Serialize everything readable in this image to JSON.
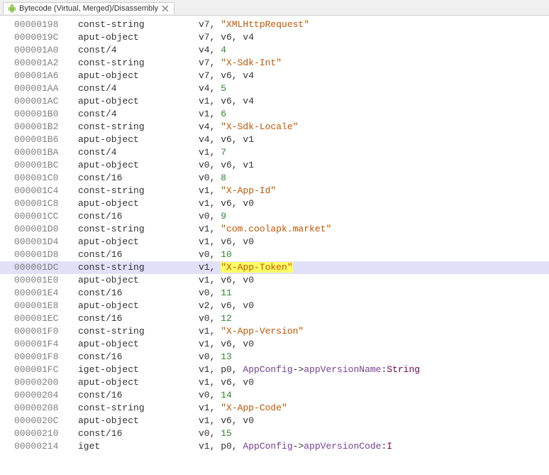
{
  "tab": {
    "title": "Bytecode (Virtual, Merged)/Disassembly",
    "icon_name": "android-icon"
  },
  "rows": [
    {
      "addr": "00000198",
      "op": "const-string",
      "args": [
        {
          "t": "plain",
          "v": "v7, "
        },
        {
          "t": "str",
          "v": "\"XMLHttpRequest\""
        }
      ]
    },
    {
      "addr": "0000019C",
      "op": "aput-object",
      "args": [
        {
          "t": "plain",
          "v": "v7, v6, v4"
        }
      ]
    },
    {
      "addr": "000001A0",
      "op": "const/4",
      "args": [
        {
          "t": "plain",
          "v": "v4, "
        },
        {
          "t": "num",
          "v": "4"
        }
      ]
    },
    {
      "addr": "000001A2",
      "op": "const-string",
      "args": [
        {
          "t": "plain",
          "v": "v7, "
        },
        {
          "t": "str",
          "v": "\"X-Sdk-Int\""
        }
      ]
    },
    {
      "addr": "000001A6",
      "op": "aput-object",
      "args": [
        {
          "t": "plain",
          "v": "v7, v6, v4"
        }
      ]
    },
    {
      "addr": "000001AA",
      "op": "const/4",
      "args": [
        {
          "t": "plain",
          "v": "v4, "
        },
        {
          "t": "num",
          "v": "5"
        }
      ]
    },
    {
      "addr": "000001AC",
      "op": "aput-object",
      "args": [
        {
          "t": "plain",
          "v": "v1, v6, v4"
        }
      ]
    },
    {
      "addr": "000001B0",
      "op": "const/4",
      "args": [
        {
          "t": "plain",
          "v": "v1, "
        },
        {
          "t": "num",
          "v": "6"
        }
      ]
    },
    {
      "addr": "000001B2",
      "op": "const-string",
      "args": [
        {
          "t": "plain",
          "v": "v4, "
        },
        {
          "t": "str",
          "v": "\"X-Sdk-Locale\""
        }
      ]
    },
    {
      "addr": "000001B6",
      "op": "aput-object",
      "args": [
        {
          "t": "plain",
          "v": "v4, v6, v1"
        }
      ]
    },
    {
      "addr": "000001BA",
      "op": "const/4",
      "args": [
        {
          "t": "plain",
          "v": "v1, "
        },
        {
          "t": "num",
          "v": "7"
        }
      ]
    },
    {
      "addr": "000001BC",
      "op": "aput-object",
      "args": [
        {
          "t": "plain",
          "v": "v0, v6, v1"
        }
      ]
    },
    {
      "addr": "000001C0",
      "op": "const/16",
      "args": [
        {
          "t": "plain",
          "v": "v0, "
        },
        {
          "t": "num",
          "v": "8"
        }
      ]
    },
    {
      "addr": "000001C4",
      "op": "const-string",
      "args": [
        {
          "t": "plain",
          "v": "v1, "
        },
        {
          "t": "str",
          "v": "\"X-App-Id\""
        }
      ]
    },
    {
      "addr": "000001C8",
      "op": "aput-object",
      "args": [
        {
          "t": "plain",
          "v": "v1, v6, v0"
        }
      ]
    },
    {
      "addr": "000001CC",
      "op": "const/16",
      "args": [
        {
          "t": "plain",
          "v": "v0, "
        },
        {
          "t": "num",
          "v": "9"
        }
      ]
    },
    {
      "addr": "000001D0",
      "op": "const-string",
      "args": [
        {
          "t": "plain",
          "v": "v1, "
        },
        {
          "t": "str",
          "v": "\"com.coolapk.market\""
        }
      ]
    },
    {
      "addr": "000001D4",
      "op": "aput-object",
      "args": [
        {
          "t": "plain",
          "v": "v1, v6, v0"
        }
      ]
    },
    {
      "addr": "000001D8",
      "op": "const/16",
      "args": [
        {
          "t": "plain",
          "v": "v0, "
        },
        {
          "t": "num",
          "v": "10"
        }
      ]
    },
    {
      "addr": "000001DC",
      "op": "const-string",
      "hl": true,
      "args": [
        {
          "t": "plain",
          "v": "v1, "
        },
        {
          "t": "strmark",
          "v": "\"X-App-Token\""
        }
      ]
    },
    {
      "addr": "000001E0",
      "op": "aput-object",
      "args": [
        {
          "t": "plain",
          "v": "v1, v6, v0"
        }
      ]
    },
    {
      "addr": "000001E4",
      "op": "const/16",
      "args": [
        {
          "t": "plain",
          "v": "v0, "
        },
        {
          "t": "num",
          "v": "11"
        }
      ]
    },
    {
      "addr": "000001E8",
      "op": "aput-object",
      "args": [
        {
          "t": "plain",
          "v": "v2, v6, v0"
        }
      ]
    },
    {
      "addr": "000001EC",
      "op": "const/16",
      "args": [
        {
          "t": "plain",
          "v": "v0, "
        },
        {
          "t": "num",
          "v": "12"
        }
      ]
    },
    {
      "addr": "000001F0",
      "op": "const-string",
      "args": [
        {
          "t": "plain",
          "v": "v1, "
        },
        {
          "t": "str",
          "v": "\"X-App-Version\""
        }
      ]
    },
    {
      "addr": "000001F4",
      "op": "aput-object",
      "args": [
        {
          "t": "plain",
          "v": "v1, v6, v0"
        }
      ]
    },
    {
      "addr": "000001F8",
      "op": "const/16",
      "args": [
        {
          "t": "plain",
          "v": "v0, "
        },
        {
          "t": "num",
          "v": "13"
        }
      ]
    },
    {
      "addr": "000001FC",
      "op": "iget-object",
      "args": [
        {
          "t": "plain",
          "v": "v1, p0, "
        },
        {
          "t": "ref",
          "v": "AppConfig"
        },
        {
          "t": "plain",
          "v": "->"
        },
        {
          "t": "ref",
          "v": "appVersionName"
        },
        {
          "t": "plain",
          "v": ":"
        },
        {
          "t": "type",
          "v": "String"
        }
      ]
    },
    {
      "addr": "00000200",
      "op": "aput-object",
      "args": [
        {
          "t": "plain",
          "v": "v1, v6, v0"
        }
      ]
    },
    {
      "addr": "00000204",
      "op": "const/16",
      "args": [
        {
          "t": "plain",
          "v": "v0, "
        },
        {
          "t": "num",
          "v": "14"
        }
      ]
    },
    {
      "addr": "00000208",
      "op": "const-string",
      "args": [
        {
          "t": "plain",
          "v": "v1, "
        },
        {
          "t": "str",
          "v": "\"X-App-Code\""
        }
      ]
    },
    {
      "addr": "0000020C",
      "op": "aput-object",
      "args": [
        {
          "t": "plain",
          "v": "v1, v6, v0"
        }
      ]
    },
    {
      "addr": "00000210",
      "op": "const/16",
      "args": [
        {
          "t": "plain",
          "v": "v0, "
        },
        {
          "t": "num",
          "v": "15"
        }
      ]
    },
    {
      "addr": "00000214",
      "op": "iget",
      "args": [
        {
          "t": "plain",
          "v": "v1, p0, "
        },
        {
          "t": "ref",
          "v": "AppConfig"
        },
        {
          "t": "plain",
          "v": "->"
        },
        {
          "t": "ref",
          "v": "appVersionCode"
        },
        {
          "t": "plain",
          "v": ":"
        },
        {
          "t": "type",
          "v": "I"
        }
      ]
    }
  ]
}
